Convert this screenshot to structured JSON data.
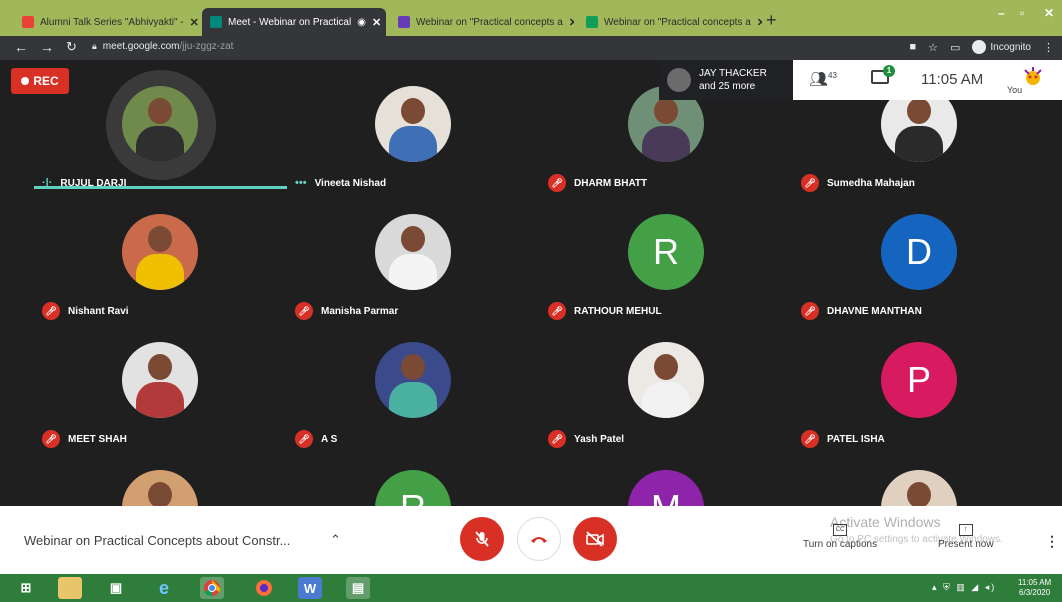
{
  "browser": {
    "tabs": [
      {
        "label": "Alumni Talk Series \"Abhivyakti\" -",
        "color": "#ea4335"
      },
      {
        "label": "Meet - Webinar on Practical",
        "color": "#00897b"
      },
      {
        "label": "Webinar on \"Practical concepts a",
        "color": "#673ab7"
      },
      {
        "label": "Webinar on \"Practical concepts a",
        "color": "#0f9d58"
      }
    ],
    "new_tab": "+",
    "url_host": "meet.google.com",
    "url_path": "/jju-zggz-zat",
    "incognito_label": "Incognito",
    "window_controls": [
      "–",
      "▫",
      "✕"
    ]
  },
  "meet": {
    "rec_label": "REC",
    "participants_chip": {
      "line1": "JAY THACKER",
      "line2": "and 25 more"
    },
    "people_count": "43",
    "chat_badge": "1",
    "clock": "11:05 AM",
    "self_label": "You",
    "participants": [
      {
        "name": "RUJUL DARJI",
        "type": "photo",
        "status": "speaking",
        "bg": "#6f8a4a",
        "shirt": "#2f2f2f"
      },
      {
        "name": "Vineeta Nishad",
        "type": "photo",
        "status": "dots",
        "bg": "#e6e0d8",
        "shirt": "#3f6fb5"
      },
      {
        "name": "DHARM BHATT",
        "type": "photo",
        "status": "muted",
        "bg": "#6f8f77",
        "shirt": "#4a3a5a"
      },
      {
        "name": "Sumedha Mahajan",
        "type": "photo",
        "status": "muted",
        "bg": "#e9e9e9",
        "shirt": "#2a2a2a"
      },
      {
        "name": "Nishant Ravi",
        "type": "photo",
        "status": "muted",
        "bg": "#c96a4a",
        "shirt": "#f0c000"
      },
      {
        "name": "Manisha Parmar",
        "type": "photo",
        "status": "muted",
        "bg": "#d9d9d9",
        "shirt": "#f4f4f4"
      },
      {
        "name": "RATHOUR MEHUL",
        "type": "letter",
        "letter": "R",
        "status": "muted",
        "bg": "#43a047"
      },
      {
        "name": "DHAVNE MANTHAN",
        "type": "letter",
        "letter": "D",
        "status": "muted",
        "bg": "#1565c0"
      },
      {
        "name": "MEET SHAH",
        "type": "photo",
        "status": "muted",
        "bg": "#e2e2e2",
        "shirt": "#b33a3a"
      },
      {
        "name": "A S",
        "type": "photo",
        "status": "muted",
        "bg": "#3b4a8a",
        "shirt": "#4ab0a0"
      },
      {
        "name": "Yash Patel",
        "type": "photo",
        "status": "muted",
        "bg": "#ece9e4",
        "shirt": "#f2f2f2"
      },
      {
        "name": "PATEL ISHA",
        "type": "letter",
        "letter": "P",
        "status": "muted",
        "bg": "#d81b60"
      },
      {
        "name": "",
        "type": "photo",
        "status": "none",
        "bg": "#d2a070",
        "shirt": "#8a5a40"
      },
      {
        "name": "",
        "type": "letter",
        "letter": "R",
        "status": "none",
        "bg": "#43a047"
      },
      {
        "name": "",
        "type": "letter",
        "letter": "M",
        "status": "none",
        "bg": "#8e24aa"
      },
      {
        "name": "",
        "type": "photo",
        "status": "none",
        "bg": "#e0d0c0",
        "shirt": "#c0603a"
      }
    ],
    "meeting_title": "Webinar on Practical Concepts about Constr...",
    "captions_label": "Turn on captions",
    "present_label": "Present now",
    "watermark_title": "Activate Windows",
    "watermark_sub": "Go to PC settings to activate Windows."
  },
  "taskbar": {
    "time": "11:05 AM",
    "date": "6/3/2020"
  }
}
